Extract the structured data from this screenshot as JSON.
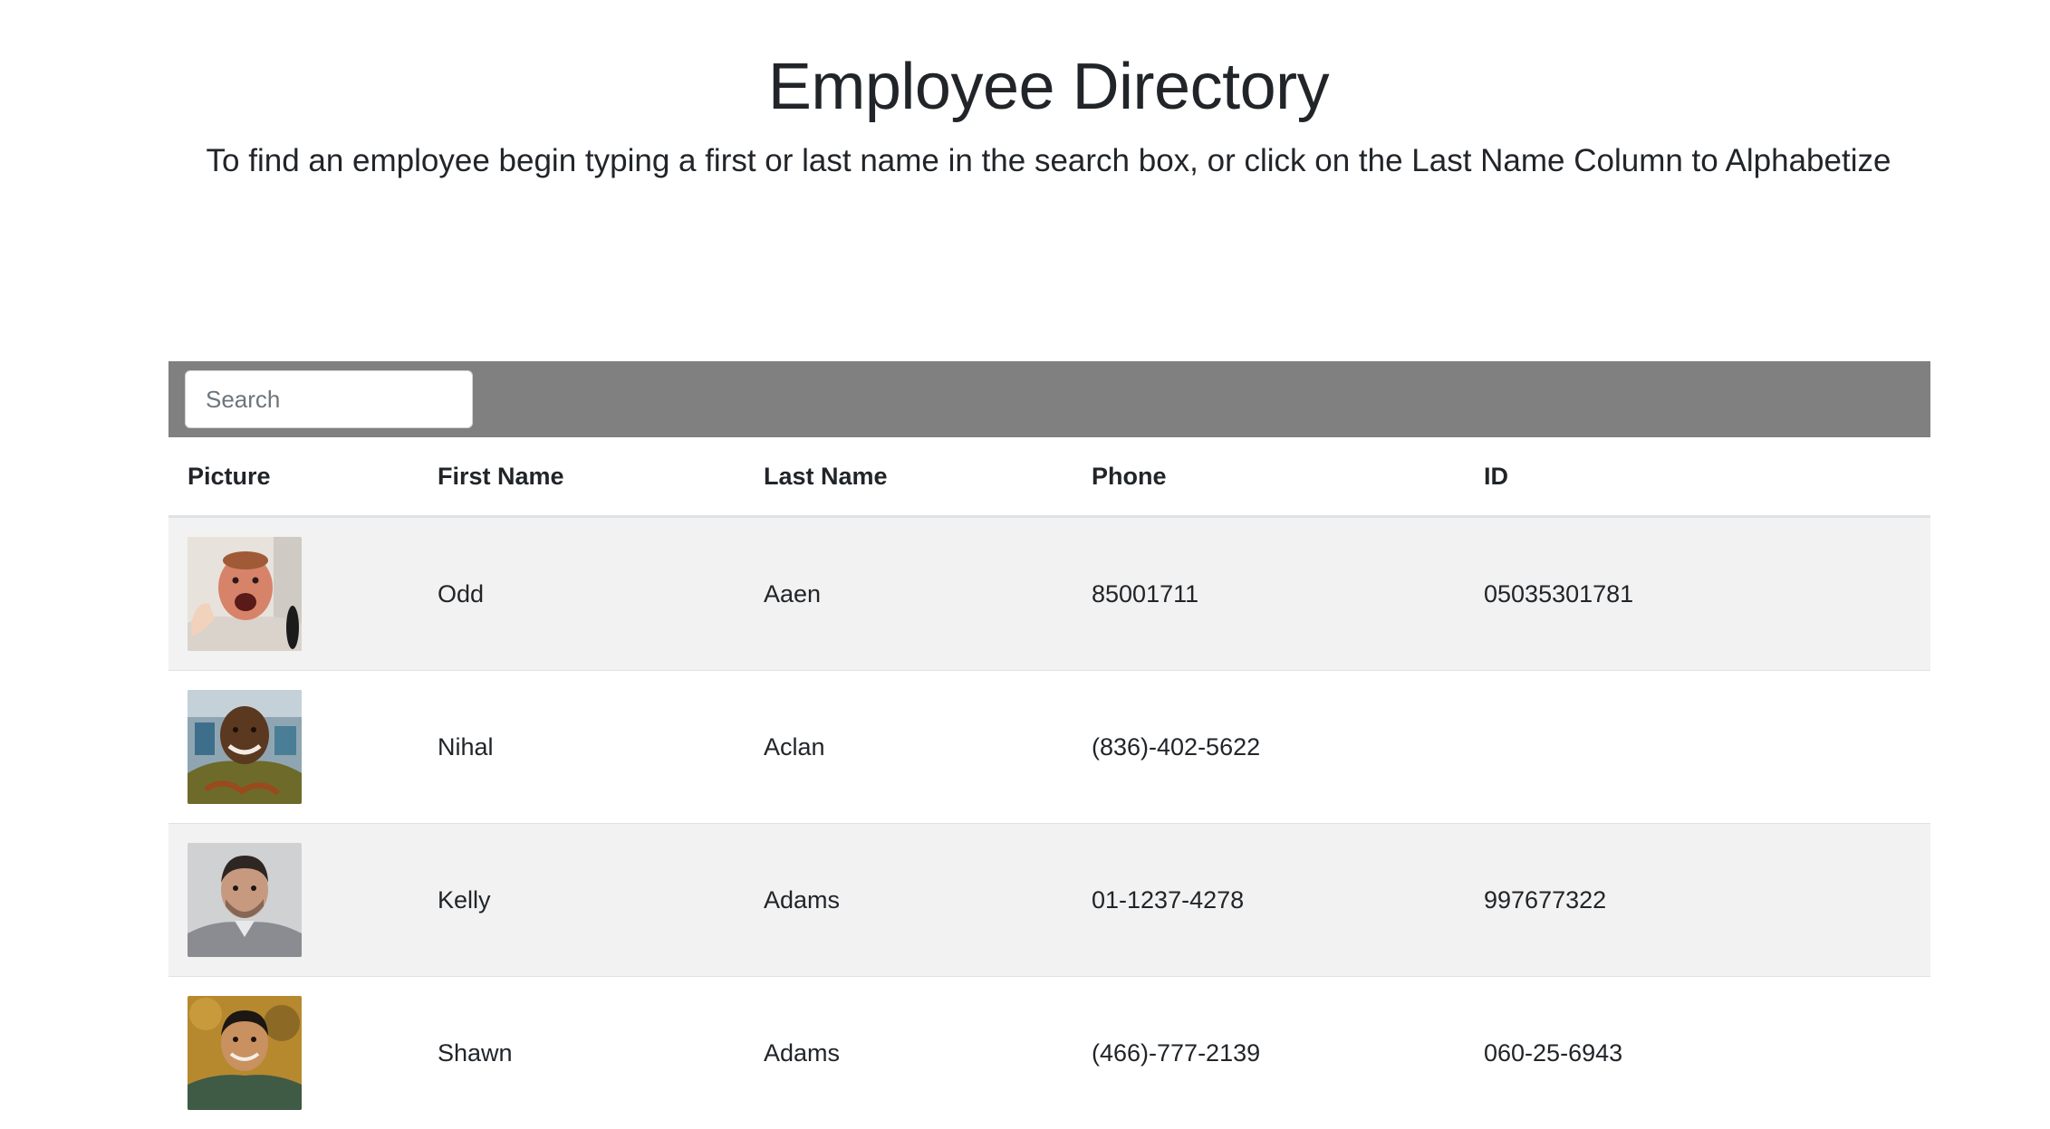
{
  "header": {
    "title": "Employee Directory",
    "subtitle": "To find an employee begin typing a first or last name in the search box, or click on the Last Name Column to Alphabetize"
  },
  "search": {
    "placeholder": "Search",
    "value": ""
  },
  "table": {
    "columns": [
      "Picture",
      "First Name",
      "Last Name",
      "Phone",
      "ID"
    ],
    "rows": [
      {
        "first": "Odd",
        "last": "Aaen",
        "phone": "85001711",
        "id": "05035301781",
        "avatar": "photo-man-thumbs-up"
      },
      {
        "first": "Nihal",
        "last": "Aclan",
        "phone": "(836)-402-5622",
        "id": "",
        "avatar": "photo-man-smiling"
      },
      {
        "first": "Kelly",
        "last": "Adams",
        "phone": "01-1237-4278",
        "id": "997677322",
        "avatar": "photo-man-portrait"
      },
      {
        "first": "Shawn",
        "last": "Adams",
        "phone": "(466)-777-2139",
        "id": "060-25-6943",
        "avatar": "photo-man-outdoors"
      }
    ]
  },
  "colors": {
    "search_bar_bg": "#808080",
    "stripe_bg": "#f2f2f2",
    "text": "#212529"
  }
}
